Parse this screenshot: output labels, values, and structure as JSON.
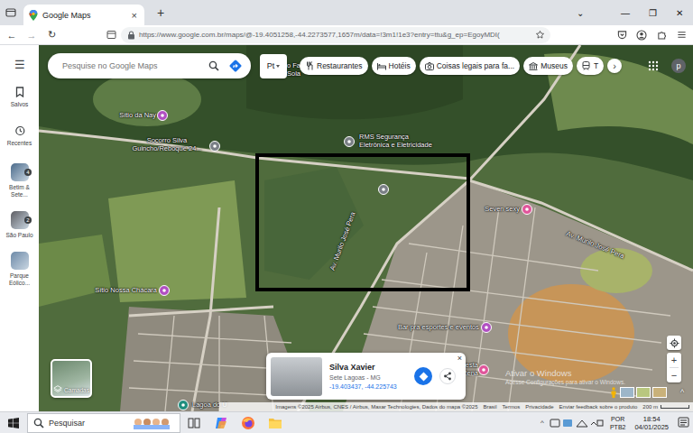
{
  "browser": {
    "tabs": [
      {
        "title": "Google Maps",
        "close": "×",
        "selected": true
      }
    ],
    "new_tab": "+",
    "window_controls": [
      "⌄",
      "—",
      "❐",
      "✕"
    ],
    "nav": [
      "←",
      "→",
      "↻"
    ],
    "url": "https://www.google.com.br/maps/@-19.4051258,-44.2273577,1657m/data=!3m1!1e3?entry=ttu&g_ep=EgoyMDI("
  },
  "sidebar": {
    "menu": "☰",
    "items": [
      {
        "label": "Salvos",
        "badge": ""
      },
      {
        "label": "Recentes",
        "badge": ""
      },
      {
        "label": "Betim & Sete...",
        "badge": "4"
      },
      {
        "label": "São Paulo",
        "badge": "2"
      },
      {
        "label": "Parque Eólico...",
        "badge": ""
      }
    ]
  },
  "search": {
    "placeholder": "Pesquise no Google Maps"
  },
  "language": {
    "label": "Pt"
  },
  "chips": [
    {
      "label": "Restaurantes"
    },
    {
      "label": "Hotéis"
    },
    {
      "label": "Coisas legais para fa..."
    },
    {
      "label": "Museus"
    },
    {
      "label": "T"
    }
  ],
  "chips_more": "›",
  "account": {
    "initial": "p"
  },
  "map": {
    "places": [
      {
        "lines": [
          "o Fa",
          "Sola"
        ],
        "color": "#7a7f86"
      },
      {
        "lines": [
          "Sítio da Nay"
        ],
        "color": "#b14fc2"
      },
      {
        "lines": [
          "Socorro Silva",
          "Guincho/Reboque 24..."
        ],
        "color": "#7a7f86"
      },
      {
        "lines": [
          "RMS Segurança",
          "Eletrônica e Eletricidade"
        ],
        "color": "#7a7f86"
      },
      {
        "lines": [],
        "color": "#7a7f86"
      },
      {
        "lines": [
          "Seven sexy"
        ],
        "color": "#e0559b"
      },
      {
        "lines": [
          "Sítio Nossa Chácara"
        ],
        "color": "#b14fc2"
      },
      {
        "lines": [
          "Bar pra esportes e eventos"
        ],
        "color": "#b14fc2"
      },
      {
        "lines": [
          "Festa",
          "Pena"
        ],
        "color": "#e0559b"
      },
      {
        "lines": [
          "Lagoa do U"
        ],
        "color": "#1e8e7e"
      }
    ],
    "roads": [
      {
        "label": "Av. Murilo José Pera"
      },
      {
        "label": "Av. Murilo José Pera"
      }
    ]
  },
  "place_card": {
    "title": "Silva Xavier",
    "subtitle": "Sete Lagoas - MG",
    "coords": "-19.403437, -44.225743",
    "close": "×"
  },
  "layers": {
    "label": "Camadas"
  },
  "zoom": {
    "in": "+",
    "out": "−",
    "expand": "^"
  },
  "watermark": {
    "title": "Ativar o Windows",
    "subtitle": "Acesse Configurações para ativar o Windows."
  },
  "footer": {
    "items": [
      "Imagens ©2025 Airbus, CNES / Airbus, Maxar Technologies, Dados do mapa ©2025",
      "Brasil",
      "Termos",
      "Privacidade",
      "Enviar feedback sobre o produto"
    ],
    "scale": "200 m"
  },
  "taskbar": {
    "search": "Pesquisar",
    "tray_arrow": "^",
    "language": "POR",
    "layout": "PTB2",
    "time": "18:54",
    "date": "04/01/2025"
  }
}
